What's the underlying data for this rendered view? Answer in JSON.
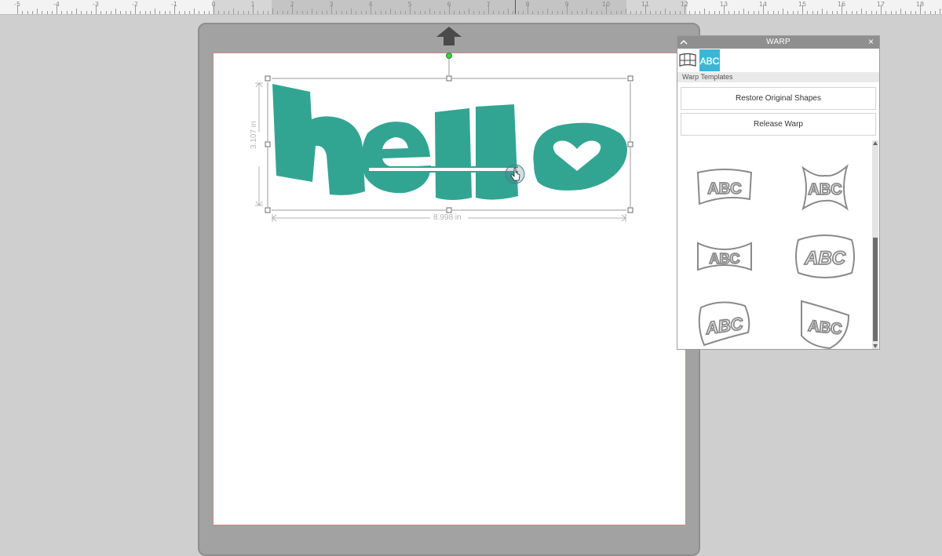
{
  "ruler": {
    "labels": [
      "-5",
      "-4",
      "-3",
      "-2",
      "-1",
      "0",
      "1",
      "2",
      "3",
      "4",
      "5",
      "6",
      "7",
      "8",
      "9",
      "10",
      "11",
      "12",
      "13",
      "14",
      "15",
      "16",
      "17",
      "18"
    ]
  },
  "canvas": {
    "artwork_text": "hello",
    "artwork_color": "#32a592",
    "width_label": "8.998 in",
    "height_label": "3.107 in"
  },
  "warp_panel": {
    "title": "WARP",
    "section_label": "Warp Templates",
    "restore_button": "Restore Original Shapes",
    "release_button": "Release Warp",
    "tab_icons": [
      "warp-grid-icon",
      "warp-text-icon"
    ],
    "template_text": "ABC",
    "templates": [
      "arch-wave",
      "bulge-pinch",
      "bowtie",
      "barrel",
      "flag-twist",
      "shield-arc"
    ]
  }
}
